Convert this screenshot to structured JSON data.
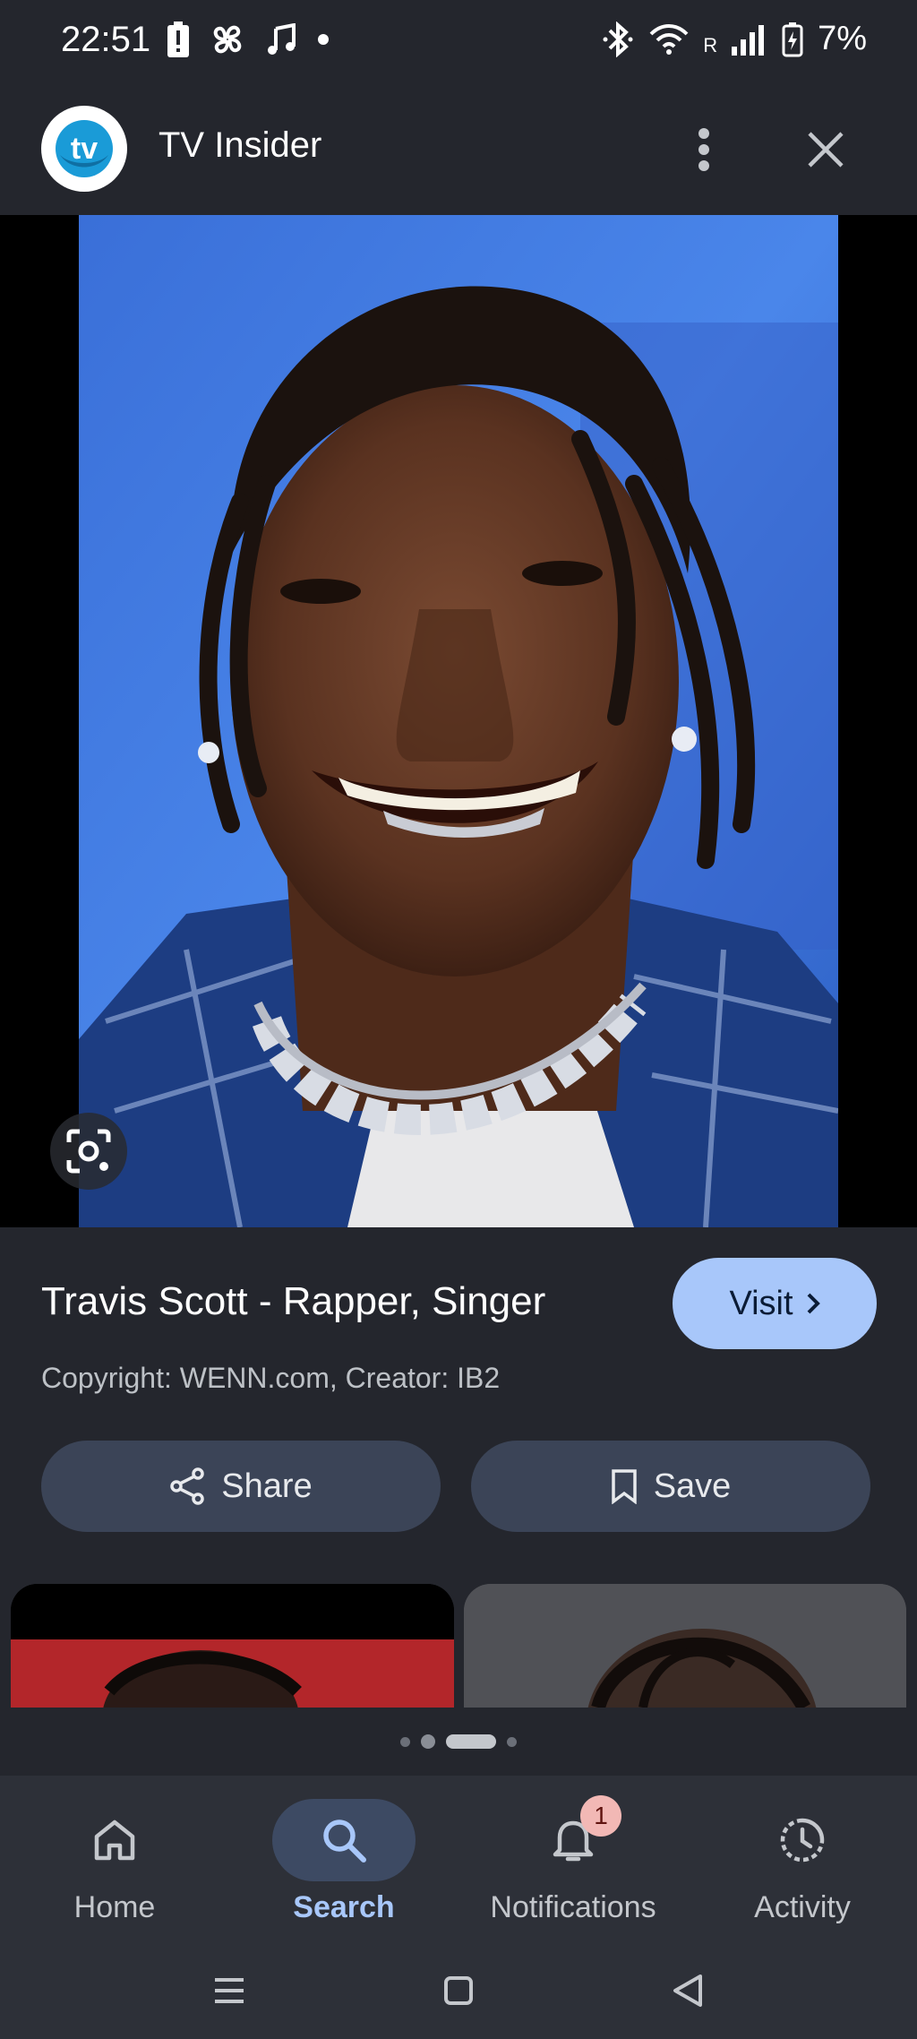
{
  "status_bar": {
    "time": "22:51",
    "battery_percent": "7%",
    "network_roaming": "R"
  },
  "header": {
    "logo_text": "tv",
    "source_name": "TV Insider"
  },
  "result": {
    "title": "Travis Scott - Rapper, Singer",
    "copyright": "Copyright: WENN.com, Creator: IB2",
    "visit_label": "Visit",
    "share_label": "Share",
    "save_label": "Save"
  },
  "bottom_nav": {
    "items": [
      {
        "label": "Home",
        "icon": "home-icon",
        "active": false
      },
      {
        "label": "Search",
        "icon": "search-icon",
        "active": true
      },
      {
        "label": "Notifications",
        "icon": "bell-icon",
        "active": false,
        "badge": "1"
      },
      {
        "label": "Activity",
        "icon": "activity-icon",
        "active": false
      }
    ]
  },
  "colors": {
    "background": "#24262d",
    "accent": "#a8c7fa",
    "pill": "#3b4457",
    "badge": "#f2b8b5"
  }
}
